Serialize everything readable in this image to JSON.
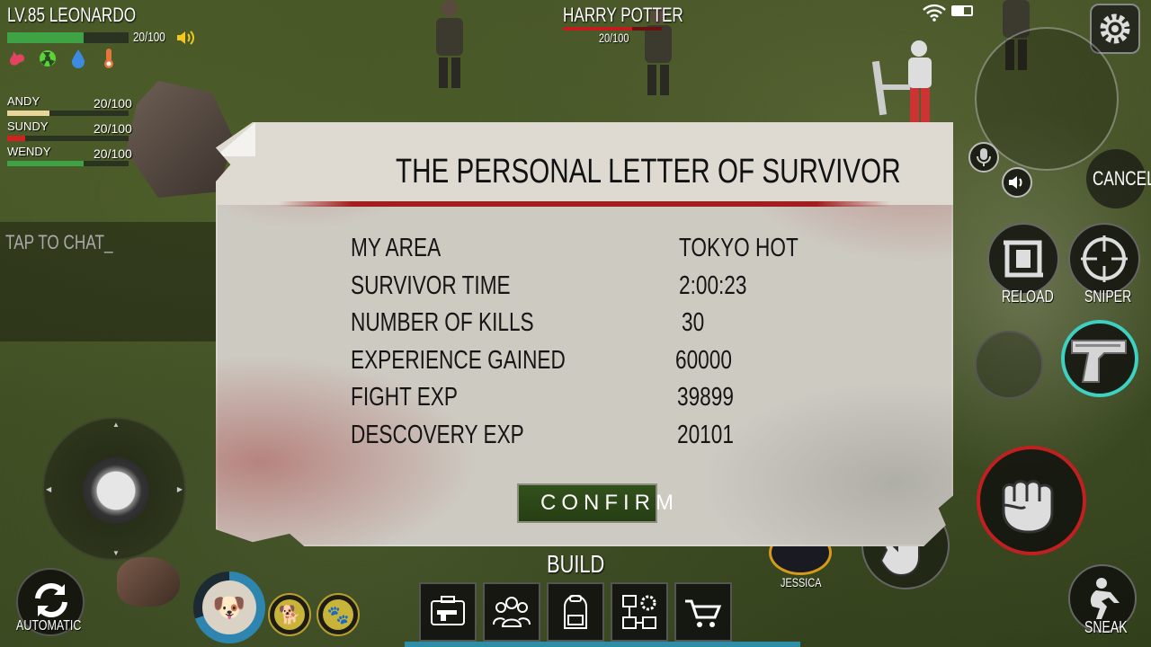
{
  "player": {
    "level_name": "LV.85  LEONARDO",
    "hp_text": "20/100",
    "hp_fraction": 0.63
  },
  "stat_icons": [
    "stomach-icon",
    "radiation-icon",
    "water-drop-icon",
    "thermometer-icon"
  ],
  "party": [
    {
      "name": "ANDY",
      "hp": "20/100",
      "fill": 0.35,
      "color": "#e9d59a"
    },
    {
      "name": "SUNDY",
      "hp": "20/100",
      "fill": 0.15,
      "color": "#d42020"
    },
    {
      "name": "WENDY",
      "hp": "20/100",
      "fill": 0.63,
      "color": "#3ea344"
    }
  ],
  "chat": {
    "placeholder": "TAP TO CHAT_"
  },
  "target": {
    "name": "HARRY POTTER",
    "hp": "20/100",
    "fill": 0.7
  },
  "buttons": {
    "cancel": "CANCEL",
    "reload": "RELOAD",
    "sniper": "SNIPER",
    "sneak": "SNEAK",
    "automatic": "AUTOMATIC",
    "build": "BUILD",
    "jessica": "JESSICA"
  },
  "toolbar": [
    "pistol-case-icon",
    "group-icon",
    "backpack-icon",
    "blueprint-gear-icon",
    "cart-icon"
  ],
  "dialog": {
    "title": "THE PERSONAL LETTER OF SURVIVOR",
    "rows": [
      {
        "label": "MY AREA",
        "value": "TOKYO HOT"
      },
      {
        "label": "SURVIVOR TIME",
        "value": "2:00:23"
      },
      {
        "label": "NUMBER OF KILLS",
        "value": "30"
      },
      {
        "label": "EXPERIENCE GAINED",
        "value": "60000"
      },
      {
        "label": "FIGHT EXP",
        "value": "39899"
      },
      {
        "label": "DESCOVERY EXP",
        "value": "20101"
      }
    ],
    "confirm": "CONFIRM"
  },
  "colors": {
    "health": "#3ea344",
    "danger": "#c21c1c",
    "accent_teal": "#2c8ea6",
    "confirm_green": "#2e4a19",
    "pet_gold": "#c9b43a"
  }
}
